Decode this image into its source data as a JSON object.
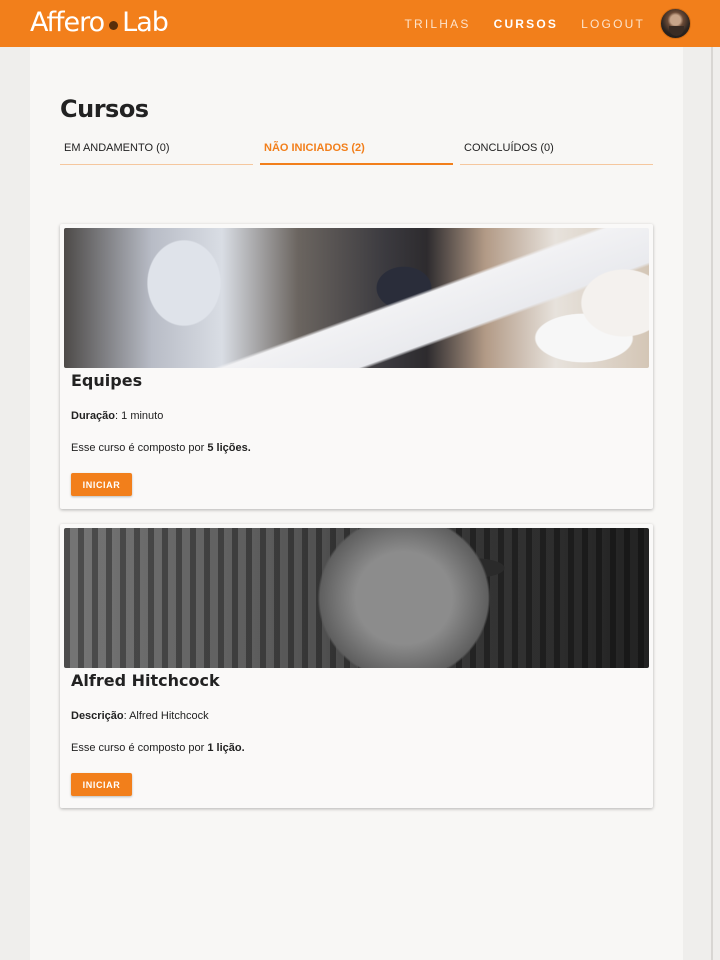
{
  "header": {
    "logo_left": "Affero",
    "logo_right": "Lab",
    "nav": [
      {
        "label": "TRILHAS",
        "active": false
      },
      {
        "label": "CURSOS",
        "active": true
      },
      {
        "label": "LOGOUT",
        "active": false
      }
    ],
    "brand_color": "#f27f1b"
  },
  "page": {
    "title": "Cursos",
    "tabs": [
      {
        "label": "EM ANDAMENTO (0)",
        "active": false
      },
      {
        "label": "NÃO INICIADOS (2)",
        "active": true
      },
      {
        "label": "CONCLUÍDOS (0)",
        "active": false
      }
    ]
  },
  "courses": [
    {
      "title": "Equipes",
      "meta_label": "Duração",
      "meta_value": ": 1 minuto",
      "count_prefix": "Esse curso é composto por ",
      "count_value": "5 lições.",
      "button_label": "INICIAR"
    },
    {
      "title": "Alfred Hitchcock",
      "meta_label": "Descrição",
      "meta_value": ": Alfred Hitchcock",
      "count_prefix": "Esse curso é composto por ",
      "count_value": "1 lição.",
      "button_label": "INICIAR"
    }
  ]
}
